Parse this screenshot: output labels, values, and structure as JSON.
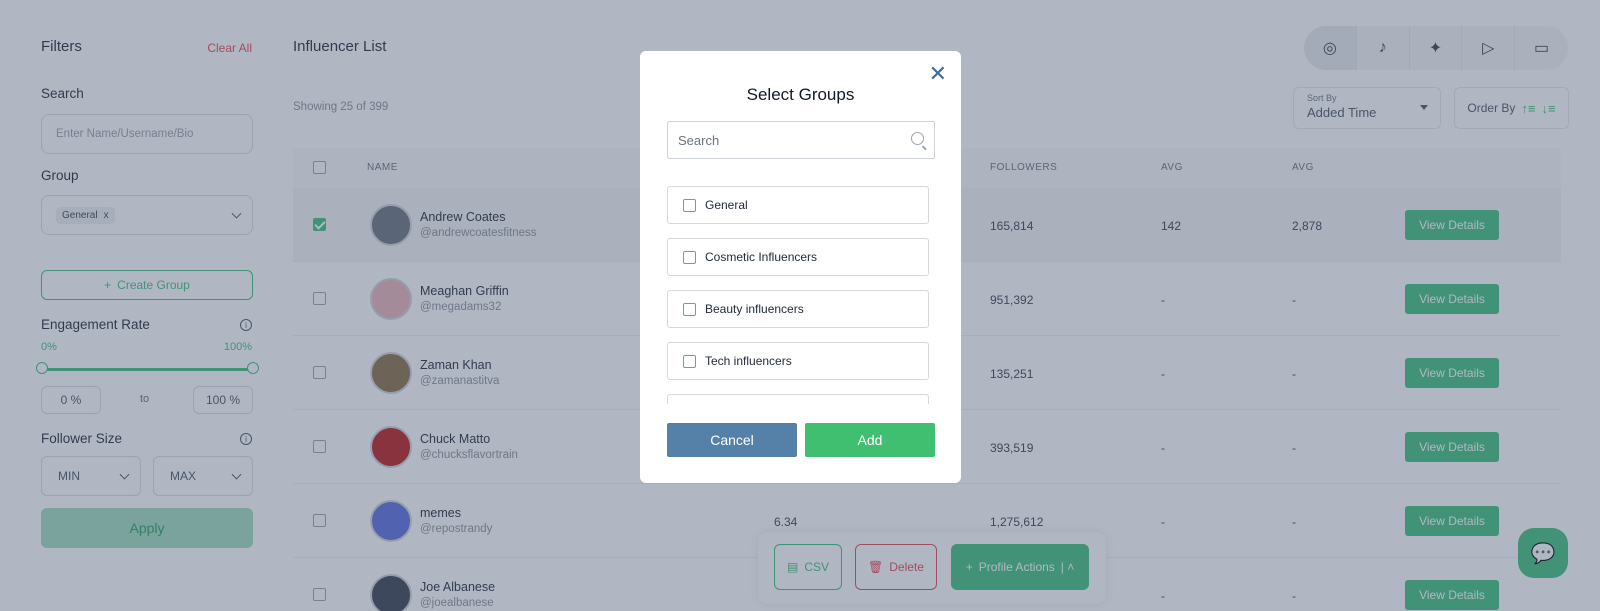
{
  "filters": {
    "title": "Filters",
    "clear_all": "Clear All",
    "search_label": "Search",
    "search_placeholder": "Enter Name/Username/Bio",
    "group_label": "Group",
    "group_chip": "General",
    "group_chip_remove": "x",
    "create_group": "Create Group",
    "engagement_label": "Engagement Rate",
    "engagement_min_label": "0%",
    "engagement_max_label": "100%",
    "engagement_min_value": "0 %",
    "engagement_max_value": "100 %",
    "to_label": "to",
    "follower_label": "Follower Size",
    "follower_min": "MIN",
    "follower_max": "MAX",
    "apply": "Apply"
  },
  "main": {
    "title": "Influencer List",
    "showing": "Showing 25 of 399",
    "platforms": [
      "instagram-icon",
      "tiktok-icon",
      "twitter-icon",
      "youtube-icon",
      "twitch-icon"
    ],
    "sort_by_label": "Sort By",
    "sort_by_value": "Added Time",
    "order_by_label": "Order By",
    "columns": {
      "name": "NAME",
      "followers": "FOLLOWERS",
      "avg1": "AVG",
      "avg2": "AVG"
    },
    "rows": [
      {
        "name": "Andrew Coates",
        "handle": "@andrewcoatesfitness",
        "er": "",
        "followers": "165,814",
        "avg1": "142",
        "avg2": "2,878",
        "checked": true,
        "action": "View Details"
      },
      {
        "name": "Meaghan Griffin",
        "handle": "@megadams32",
        "er": "",
        "followers": "951,392",
        "avg1": "-",
        "avg2": "-",
        "checked": false,
        "action": "View Details"
      },
      {
        "name": "Zaman Khan",
        "handle": "@zamanastitva",
        "er": "",
        "followers": "135,251",
        "avg1": "-",
        "avg2": "-",
        "checked": false,
        "action": "View Details"
      },
      {
        "name": "Chuck Matto",
        "handle": "@chucksflavortrain",
        "er": "",
        "followers": "393,519",
        "avg1": "-",
        "avg2": "-",
        "checked": false,
        "action": "View Details"
      },
      {
        "name": "memes",
        "handle": "@repostrandy",
        "er": "6.34",
        "followers": "1,275,612",
        "avg1": "-",
        "avg2": "-",
        "checked": false,
        "action": "View Details"
      },
      {
        "name": "Joe Albanese",
        "handle": "@joealbanese",
        "er": "",
        "followers": "",
        "avg1": "-",
        "avg2": "-",
        "checked": false,
        "action": "View Details"
      }
    ]
  },
  "actions": {
    "csv": "CSV",
    "delete": "Delete",
    "profile_actions": "Profile Actions"
  },
  "modal": {
    "title": "Select Groups",
    "search_placeholder": "Search",
    "groups": [
      "General",
      "Cosmetic Influencers",
      "Beauty influencers",
      "Tech influencers"
    ],
    "cancel": "Cancel",
    "add": "Add"
  },
  "colors": {
    "accent": "#3fbf7f",
    "danger": "#e0495b",
    "cancel_button": "#5580a8"
  }
}
